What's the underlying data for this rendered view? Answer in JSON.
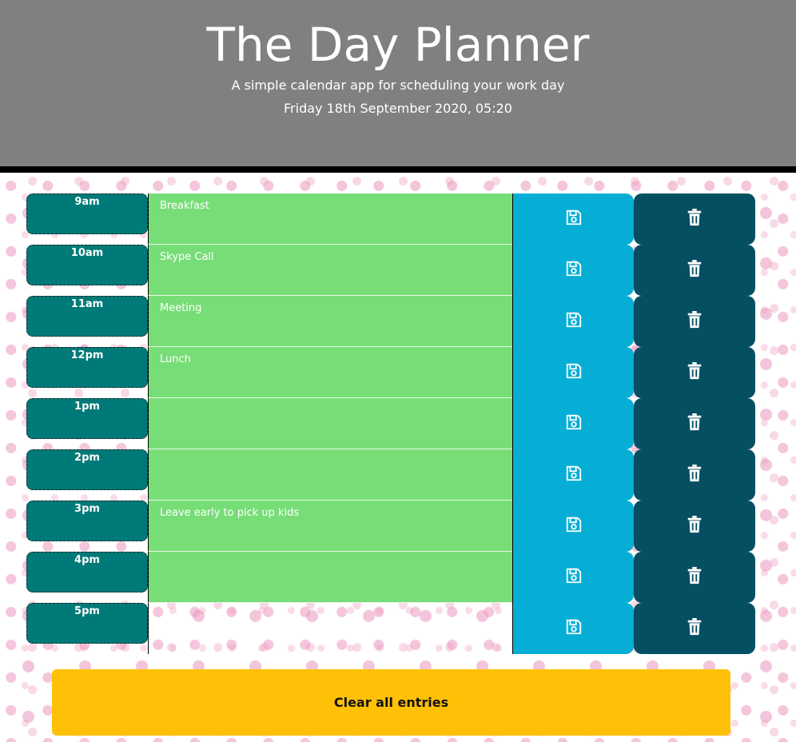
{
  "header": {
    "title": "The Day Planner",
    "subtitle": "A simple calendar app for scheduling your work day",
    "date": "Friday 18th September 2020, 05:20",
    "bg_color": "#808080"
  },
  "rows": [
    {
      "hour": "9am",
      "entry": "Breakfast"
    },
    {
      "hour": "10am",
      "entry": "Skype Call"
    },
    {
      "hour": "11am",
      "entry": "Meeting"
    },
    {
      "hour": "12pm",
      "entry": "Lunch"
    },
    {
      "hour": "1pm",
      "entry": ""
    },
    {
      "hour": "2pm",
      "entry": ""
    },
    {
      "hour": "3pm",
      "entry": "Leave early to pick up kids"
    },
    {
      "hour": "4pm",
      "entry": ""
    },
    {
      "hour": "5pm",
      "entry": ""
    }
  ],
  "icons": {
    "save": "floppy-disk-icon",
    "delete": "trash-icon"
  },
  "colors": {
    "hour_block": "#007a78",
    "future_entry": "#77dd77",
    "save_button": "#06aed5",
    "delete_button": "#054f63",
    "clear_button": "#ffc107"
  },
  "clear_button_label": "Clear all entries"
}
